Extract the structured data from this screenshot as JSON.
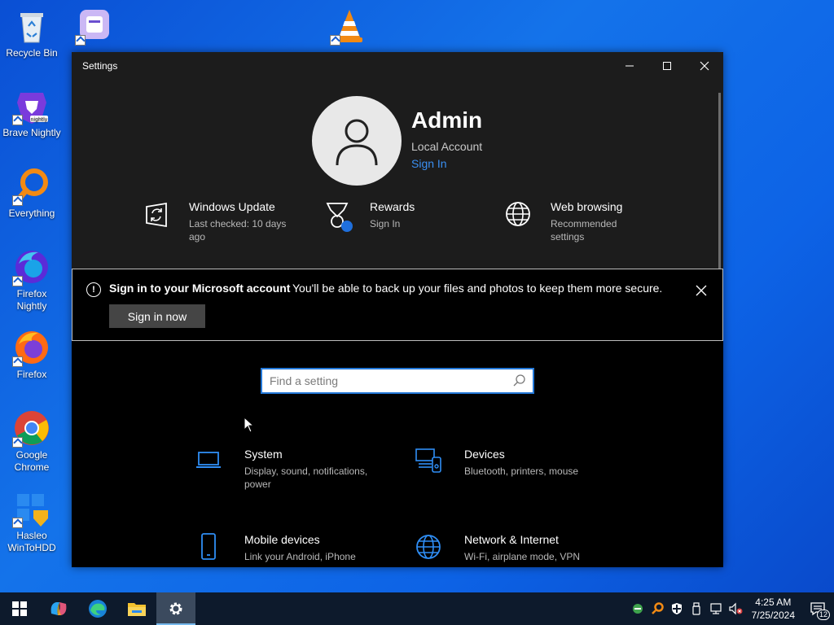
{
  "desktop": {
    "icons": [
      {
        "label": "Recycle Bin"
      },
      {
        "label": "Brave Nightly"
      },
      {
        "label": "Everything"
      },
      {
        "label": "Firefox Nightly"
      },
      {
        "label": "Firefox"
      },
      {
        "label": "Google Chrome"
      },
      {
        "label": "Hasleo WinToHDD"
      }
    ]
  },
  "window": {
    "title": "Settings",
    "controls": {
      "minimize": "minimize",
      "maximize": "maximize",
      "close": "close"
    }
  },
  "profile": {
    "name": "Admin",
    "account_type": "Local Account",
    "sign_in_link": "Sign In"
  },
  "tiles": [
    {
      "title": "Windows Update",
      "subtitle": "Last checked: 10 days ago",
      "icon": "windows-update-icon"
    },
    {
      "title": "Rewards",
      "subtitle": "Sign In",
      "icon": "rewards-icon"
    },
    {
      "title": "Web browsing",
      "subtitle": "Recommended settings",
      "icon": "globe-icon"
    }
  ],
  "banner": {
    "title": "Sign in to your Microsoft account",
    "text": "You'll be able to back up your files and photos to keep them more secure.",
    "button": "Sign in now"
  },
  "search": {
    "placeholder": "Find a setting"
  },
  "categories": [
    {
      "title": "System",
      "subtitle": "Display, sound, notifications, power",
      "icon": "laptop-icon"
    },
    {
      "title": "Devices",
      "subtitle": "Bluetooth, printers, mouse",
      "icon": "devices-icon"
    },
    {
      "title": "Mobile devices",
      "subtitle": "Link your Android, iPhone",
      "icon": "phone-icon"
    },
    {
      "title": "Network & Internet",
      "subtitle": "Wi-Fi, airplane mode, VPN",
      "icon": "globe-icon"
    }
  ],
  "taskbar": {
    "clock_time": "4:25 AM",
    "clock_date": "7/25/2024",
    "notification_count": "12"
  },
  "colors": {
    "accent": "#3a8ff2",
    "desktop": "#1473ea",
    "window_bg": "#000000",
    "header_bg": "#1c1c1c"
  }
}
